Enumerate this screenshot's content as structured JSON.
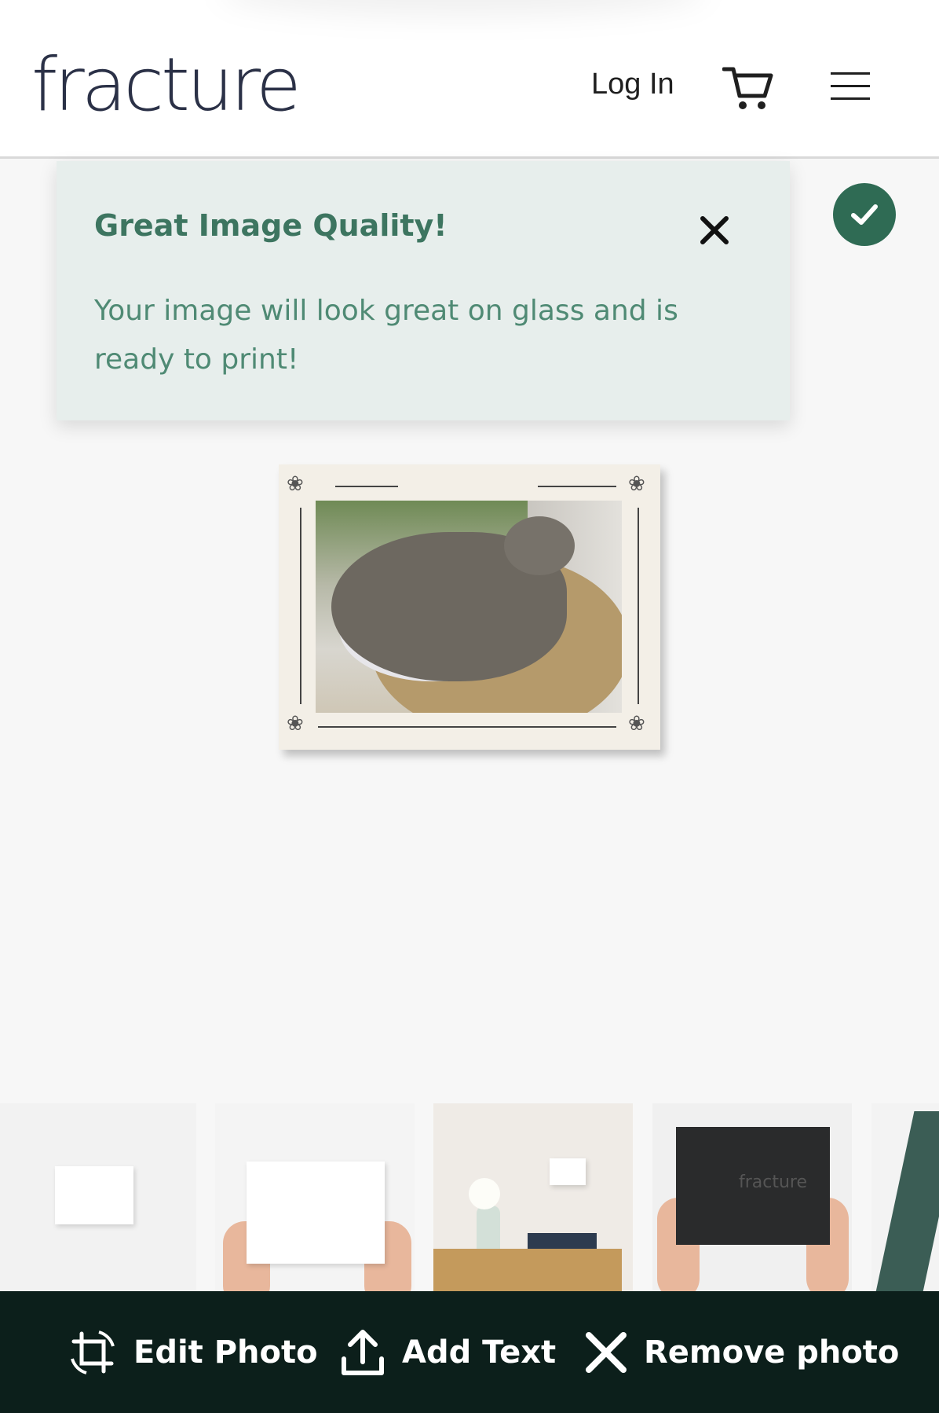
{
  "header": {
    "logo": "fracture",
    "login": "Log In",
    "cart_icon": "cart-icon",
    "menu_icon": "menu-icon"
  },
  "tooltip": {
    "title": "Great Image Quality!",
    "body": "Your image will look great on glass and is ready to print!",
    "close_icon": "close-icon"
  },
  "status": {
    "icon": "check-icon",
    "color": "#2f6b54"
  },
  "preview": {
    "frame_color": "#f3efe7",
    "decoration_icon": "paw-icon"
  },
  "thumbnails": {
    "dark_logo": "fracture"
  },
  "actions": {
    "edit": "Edit Photo",
    "edit_icon": "crop-rotate-icon",
    "text": "Add Text",
    "text_icon": "upload-icon",
    "remove": "Remove photo",
    "remove_icon": "close-icon"
  },
  "colors": {
    "accent": "#3d7560",
    "bar": "#0c1f1b",
    "tooltip_bg": "#e7eeec"
  }
}
